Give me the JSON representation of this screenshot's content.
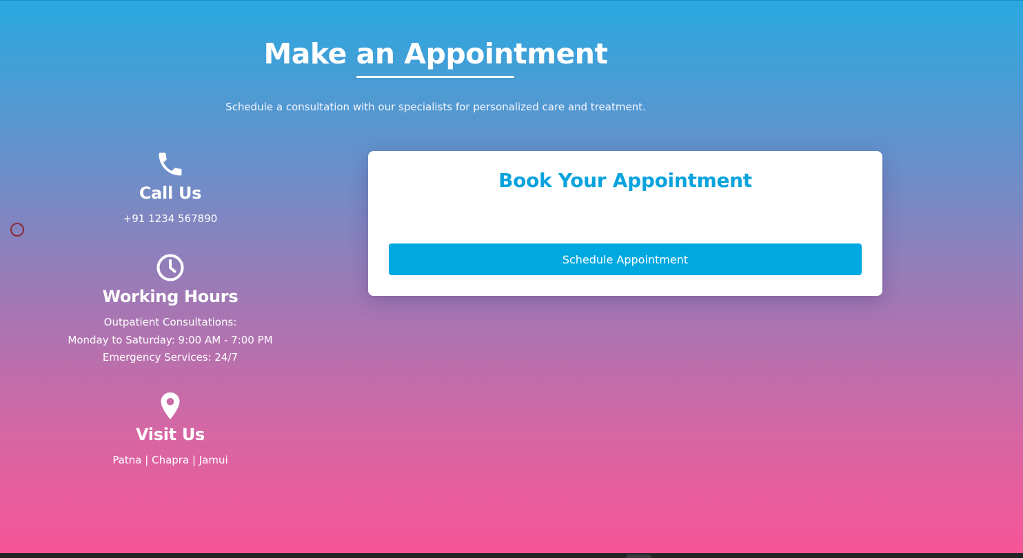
{
  "header": {
    "title": "Make an Appointment",
    "subtitle": "Schedule a consultation with our specialists for personalized care and treatment."
  },
  "contact": {
    "call": {
      "icon": "phone-icon",
      "title": "Call Us",
      "phone": "+91 1234 567890"
    },
    "hours": {
      "icon": "clock-icon",
      "title": "Working Hours",
      "lines": [
        "Outpatient Consultations:",
        "Monday to Saturday: 9:00 AM - 7:00 PM",
        "Emergency Services: 24/7"
      ]
    },
    "visit": {
      "icon": "location-pin-icon",
      "title": "Visit Us",
      "locations": "Patna | Chapra | Jamui"
    }
  },
  "booking": {
    "title": "Book Your Appointment",
    "button_label": "Schedule Appointment"
  },
  "colors": {
    "gradient_top": "#29a9e0",
    "gradient_bottom": "#f85496",
    "accent": "#0aa3de",
    "button": "#00a8e1",
    "card": "#ffffff"
  }
}
